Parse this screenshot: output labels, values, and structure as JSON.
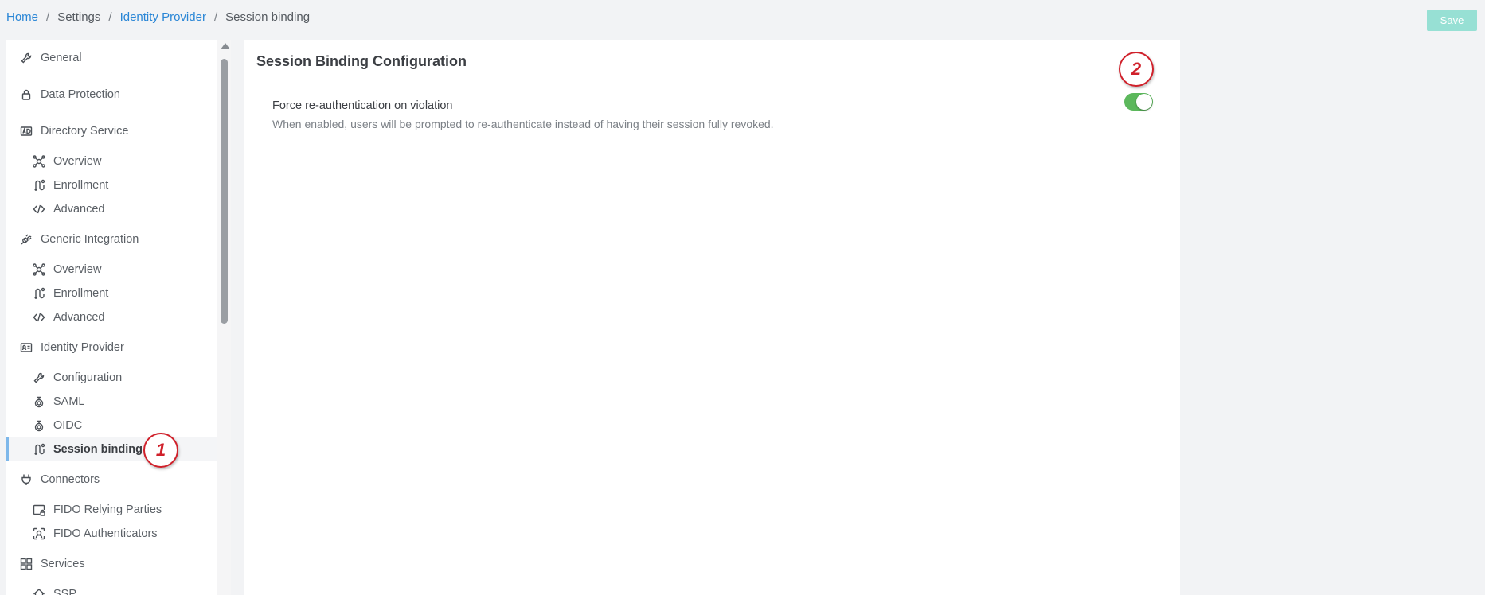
{
  "breadcrumb": {
    "home": "Home",
    "settings": "Settings",
    "identity_provider": "Identity Provider",
    "current": "Session binding",
    "separator": "/"
  },
  "toolbar": {
    "save_label": "Save"
  },
  "sidebar": {
    "items": [
      {
        "label": "General",
        "icon": "wrench-icon",
        "level": 0
      },
      {
        "label": "Data Protection",
        "icon": "lock-icon",
        "level": 0
      },
      {
        "label": "Directory Service",
        "icon": "ad-icon",
        "level": 0
      },
      {
        "label": "Overview",
        "icon": "network-icon",
        "level": 1
      },
      {
        "label": "Enrollment",
        "icon": "flow-icon",
        "level": 1
      },
      {
        "label": "Advanced",
        "icon": "code-icon",
        "level": 1
      },
      {
        "label": "Generic Integration",
        "icon": "plug-icon",
        "level": 0
      },
      {
        "label": "Overview",
        "icon": "network-icon",
        "level": 1
      },
      {
        "label": "Enrollment",
        "icon": "flow-icon",
        "level": 1
      },
      {
        "label": "Advanced",
        "icon": "code-icon",
        "level": 1
      },
      {
        "label": "Identity Provider",
        "icon": "id-card-icon",
        "level": 0
      },
      {
        "label": "Configuration",
        "icon": "wrench-icon",
        "level": 1
      },
      {
        "label": "SAML",
        "icon": "fingerprint-icon",
        "level": 1
      },
      {
        "label": "OIDC",
        "icon": "fingerprint-icon",
        "level": 1
      },
      {
        "label": "Session binding",
        "icon": "flow-icon",
        "level": 1,
        "active": true
      },
      {
        "label": "Connectors",
        "icon": "plug-connector-icon",
        "level": 0
      },
      {
        "label": "FIDO Relying Parties",
        "icon": "device-lock-icon",
        "level": 1
      },
      {
        "label": "FIDO Authenticators",
        "icon": "face-scan-icon",
        "level": 1
      },
      {
        "label": "Services",
        "icon": "grid-icon",
        "level": 0
      },
      {
        "label": "SSP",
        "icon": "home-icon",
        "level": 1
      }
    ]
  },
  "main": {
    "title": "Session Binding Configuration",
    "setting": {
      "label": "Force re-authentication on violation",
      "description": "When enabled, users will be prompted to re-authenticate instead of having their session fully revoked.",
      "enabled": true
    }
  },
  "annotations": [
    "1",
    "2"
  ],
  "colors": {
    "link": "#2a86d6",
    "save_button": "#97e0d4",
    "toggle_on": "#5cb85c",
    "active_indicator": "#7db7ea",
    "marker": "#d0202a"
  }
}
